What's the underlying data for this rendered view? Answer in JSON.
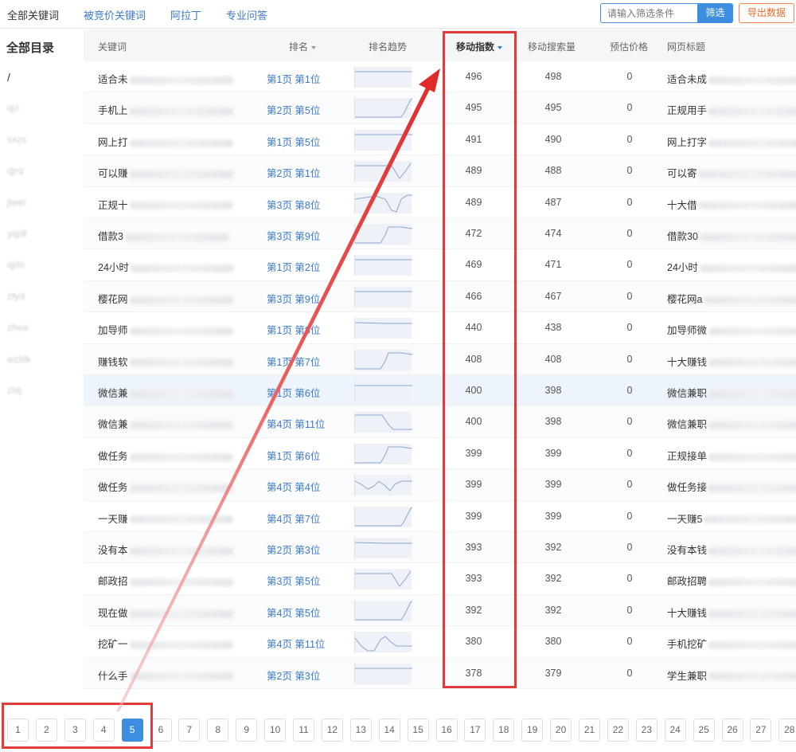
{
  "nav": {
    "tabs": [
      {
        "label": "全部关键词"
      },
      {
        "label": "被竞价关键词"
      },
      {
        "label": "阿拉丁"
      },
      {
        "label": "专业问答"
      }
    ],
    "filter_placeholder": "请输入筛选条件",
    "filter_button": "筛选",
    "export_button": "导出数据"
  },
  "sidebar": {
    "title": "全部目录",
    "items": [
      "/",
      "qjz",
      "sxzs",
      "qjrq",
      "jiwei",
      "yqpll",
      "qjds",
      "zfyd",
      "zhea",
      "wzblk",
      "zhlj"
    ]
  },
  "table": {
    "columns": [
      "关键词",
      "排名",
      "排名趋势",
      "移动指数",
      "移动搜索量",
      "预估价格",
      "网页标题"
    ],
    "sorted_column": "移动指数",
    "rows": [
      {
        "keyword": "适合未",
        "rank": "第1页 第1位",
        "index": "496",
        "volume": "498",
        "price": "0",
        "title": "适合未成",
        "trend": "flat"
      },
      {
        "keyword": "手机上",
        "rank": "第2页 第5位",
        "index": "495",
        "volume": "495",
        "price": "0",
        "title": "正规用手",
        "trend": "rise-late"
      },
      {
        "keyword": "网上打",
        "rank": "第1页 第5位",
        "index": "491",
        "volume": "490",
        "price": "0",
        "title": "网上打字",
        "trend": "flat"
      },
      {
        "keyword": "可以赚",
        "rank": "第2页 第1位",
        "index": "489",
        "volume": "488",
        "price": "0",
        "title": "可以寄",
        "trend": "dip-rise"
      },
      {
        "keyword": "正规十",
        "rank": "第3页 第8位",
        "index": "489",
        "volume": "487",
        "price": "0",
        "title": "十大借",
        "trend": "deep-dip"
      },
      {
        "keyword": "借款3",
        "rank": "第3页 第9位",
        "index": "472",
        "volume": "474",
        "price": "0",
        "title": "借款30",
        "trend": "rise-mid"
      },
      {
        "keyword": "24小时",
        "rank": "第1页 第2位",
        "index": "469",
        "volume": "471",
        "price": "0",
        "title": "24小时",
        "trend": "flat"
      },
      {
        "keyword": "樱花网",
        "rank": "第3页 第9位",
        "index": "466",
        "volume": "467",
        "price": "0",
        "title": "樱花网a",
        "trend": "flat"
      },
      {
        "keyword": "加导师",
        "rank": "第1页 第8位",
        "index": "440",
        "volume": "438",
        "price": "0",
        "title": "加导师微",
        "trend": "flat-slight"
      },
      {
        "keyword": "赚钱软",
        "rank": "第1页 第7位",
        "index": "408",
        "volume": "408",
        "price": "0",
        "title": "十大赚钱",
        "trend": "rise-mid"
      },
      {
        "keyword": "微信兼",
        "rank": "第1页 第6位",
        "index": "400",
        "volume": "398",
        "price": "0",
        "title": "微信兼职",
        "trend": "flat"
      },
      {
        "keyword": "微信兼",
        "rank": "第4页 第11位",
        "index": "400",
        "volume": "398",
        "price": "0",
        "title": "微信兼职",
        "trend": "drop-mid"
      },
      {
        "keyword": "做任务",
        "rank": "第1页 第6位",
        "index": "399",
        "volume": "399",
        "price": "0",
        "title": "正规接单",
        "trend": "rise-mid"
      },
      {
        "keyword": "做任务",
        "rank": "第4页 第4位",
        "index": "399",
        "volume": "399",
        "price": "0",
        "title": "做任务接",
        "trend": "wave"
      },
      {
        "keyword": "一天赚",
        "rank": "第4页 第7位",
        "index": "399",
        "volume": "399",
        "price": "0",
        "title": "一天赚5",
        "trend": "rise-late"
      },
      {
        "keyword": "没有本",
        "rank": "第2页 第3位",
        "index": "393",
        "volume": "392",
        "price": "0",
        "title": "没有本钱",
        "trend": "flat-slight"
      },
      {
        "keyword": "邮政招",
        "rank": "第3页 第5位",
        "index": "393",
        "volume": "392",
        "price": "0",
        "title": "邮政招聘",
        "trend": "dip-rise"
      },
      {
        "keyword": "现在做",
        "rank": "第4页 第5位",
        "index": "392",
        "volume": "392",
        "price": "0",
        "title": "十大赚钱",
        "trend": "rise-late"
      },
      {
        "keyword": "挖矿一",
        "rank": "第4页 第11位",
        "index": "380",
        "volume": "380",
        "price": "0",
        "title": "手机挖矿",
        "trend": "drop-bump"
      },
      {
        "keyword": "什么手",
        "rank": "第2页 第3位",
        "index": "378",
        "volume": "379",
        "price": "0",
        "title": "学生兼职",
        "trend": "flat"
      }
    ]
  },
  "pagination": {
    "pages": [
      "1",
      "2",
      "3",
      "4",
      "5",
      "6",
      "7",
      "8",
      "9",
      "10",
      "11",
      "12",
      "13",
      "14",
      "15",
      "16",
      "17",
      "18",
      "19",
      "20",
      "21",
      "22",
      "23",
      "24",
      "25",
      "26",
      "27",
      "28"
    ],
    "active": "5"
  },
  "colors": {
    "accent": "#3d8ee0",
    "annotation": "#e23b3b",
    "export": "#e8692a"
  }
}
